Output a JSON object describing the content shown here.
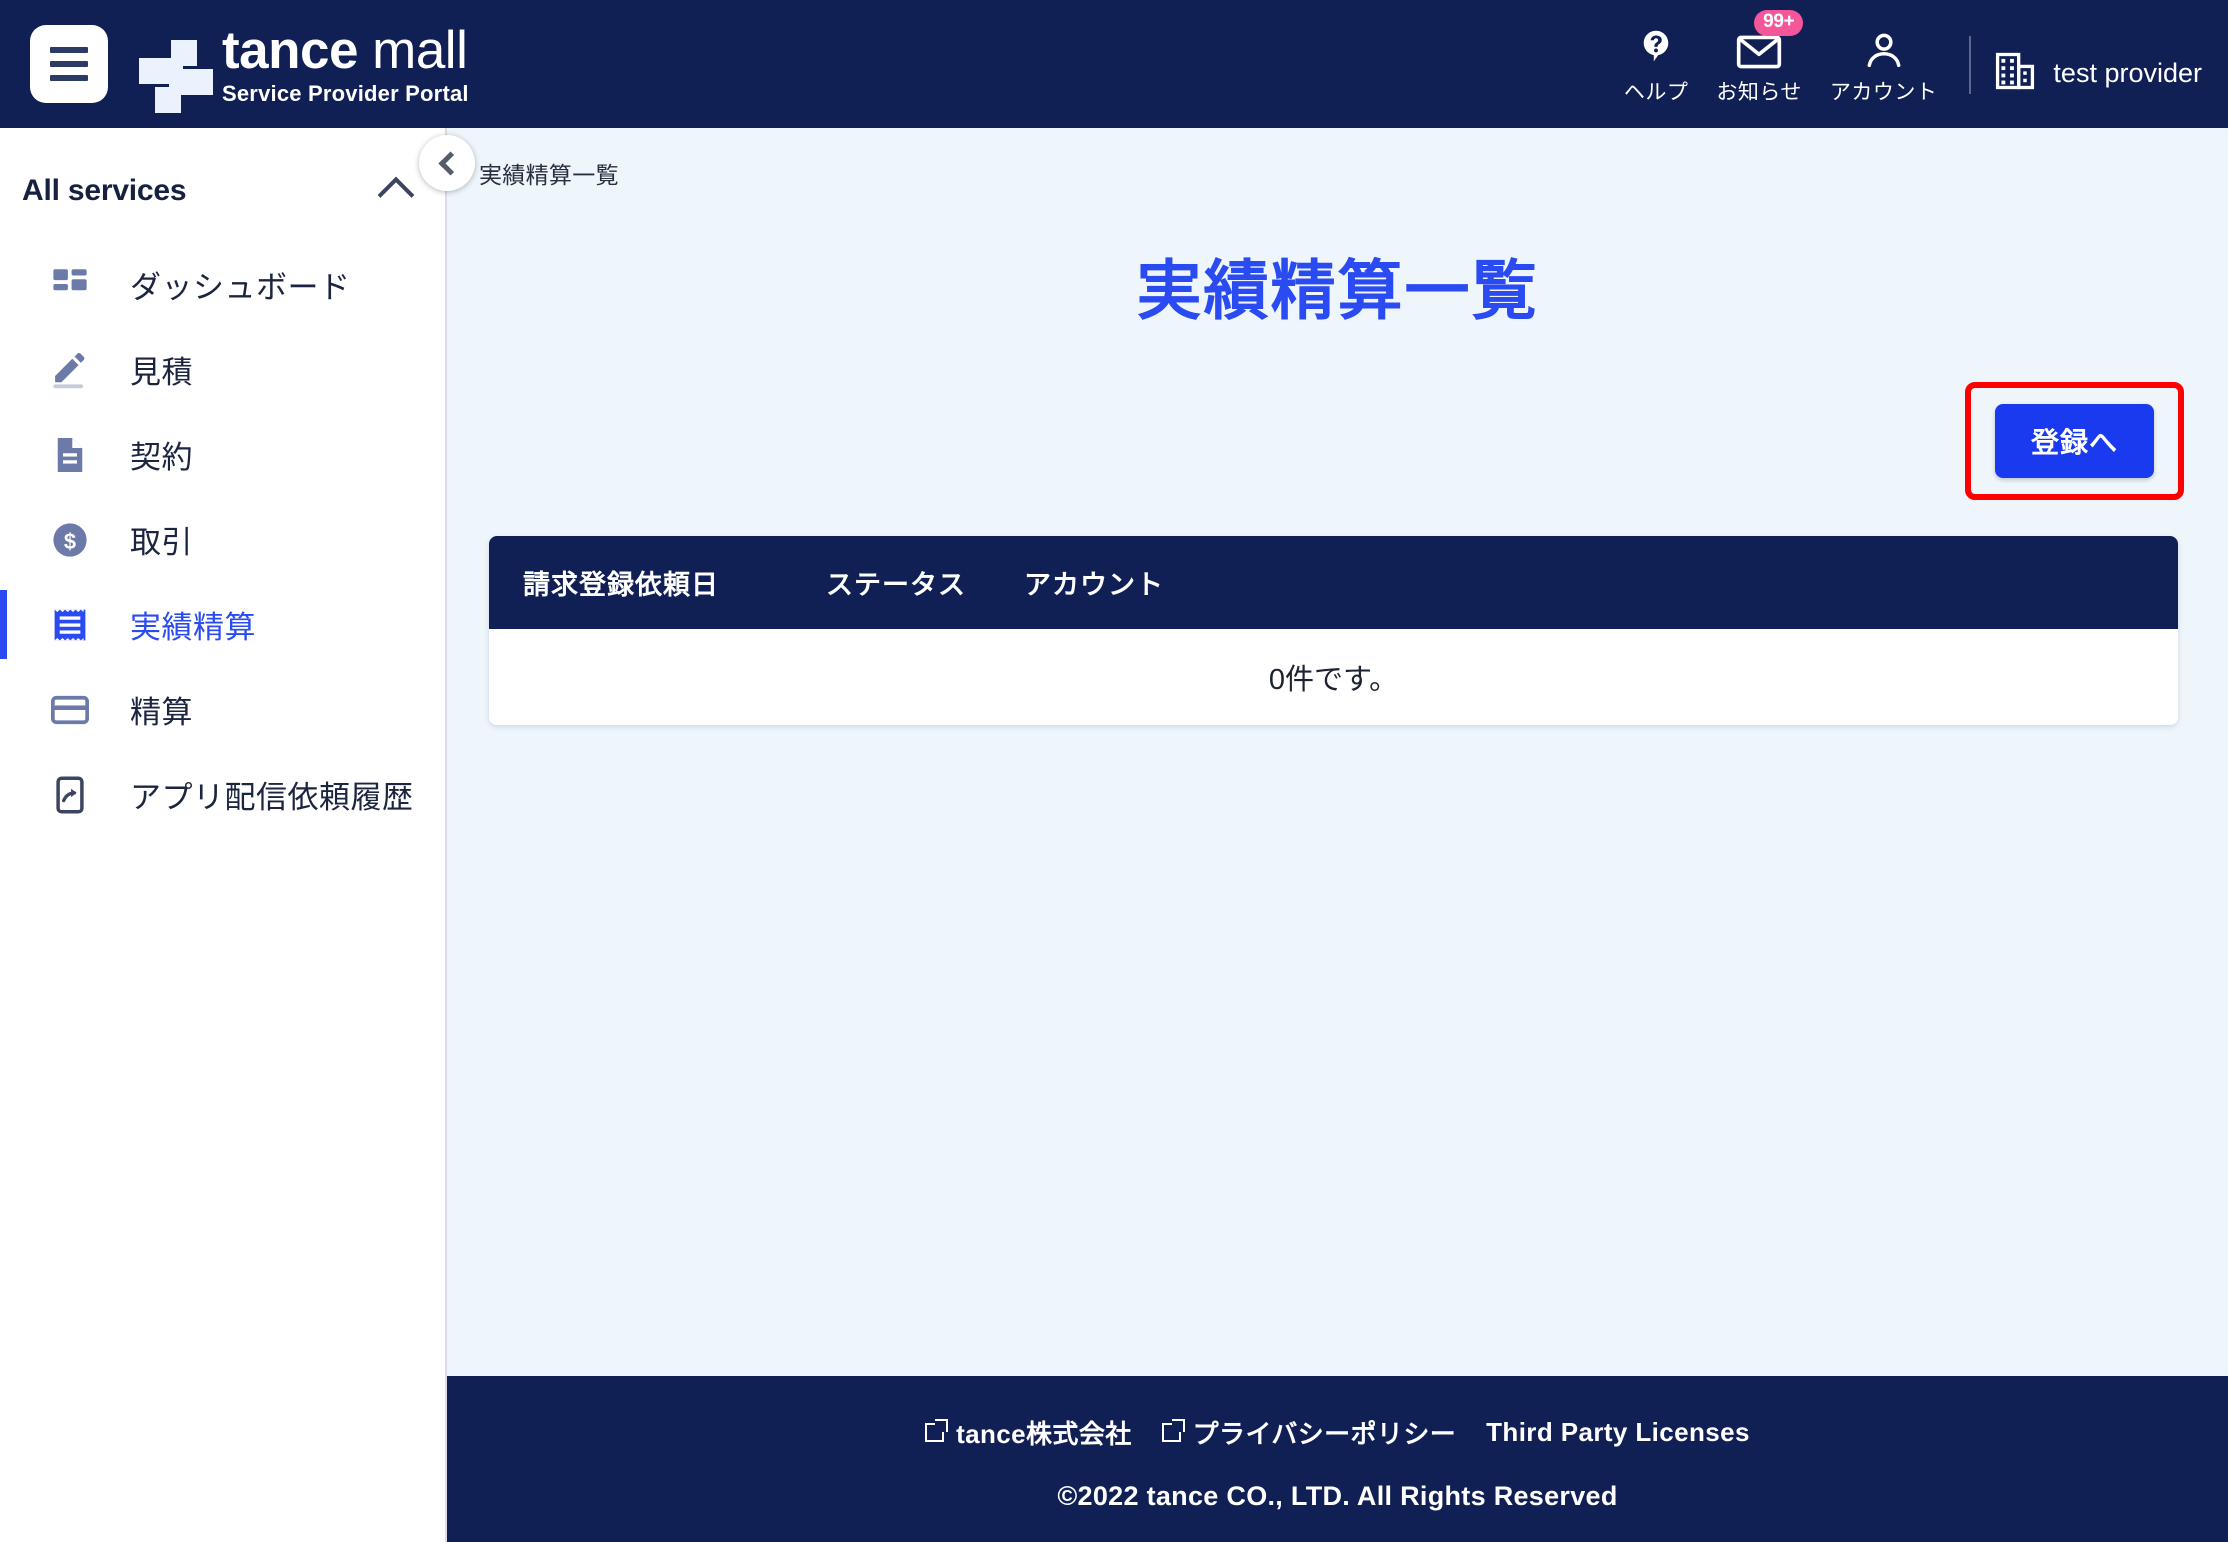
{
  "header": {
    "menu_icon": "hamburger-icon",
    "logo": {
      "brand_bold": "tance",
      "brand_light": " mall",
      "subtitle": "Service Provider Portal",
      "mark_icon": "tance-logo-mark"
    },
    "actions": [
      {
        "icon": "help-icon",
        "label": "ヘルプ",
        "badge": null
      },
      {
        "icon": "mail-icon",
        "label": "お知らせ",
        "badge": "99+"
      },
      {
        "icon": "person-icon",
        "label": "アカウント",
        "badge": null
      }
    ],
    "provider": {
      "icon": "building-icon",
      "name": "test provider"
    },
    "badge_color": "#f4569a"
  },
  "sidebar": {
    "section_label": "All services",
    "collapse_icon": "chevron-up-icon",
    "panel_collapse_icon": "chevron-left-icon",
    "items": [
      {
        "label": "ダッシュボード",
        "icon": "dashboard-icon",
        "active": false
      },
      {
        "label": "見積",
        "icon": "pencil-icon",
        "active": false
      },
      {
        "label": "契約",
        "icon": "document-icon",
        "active": false
      },
      {
        "label": "取引",
        "icon": "dollar-coin-icon",
        "active": false
      },
      {
        "label": "実績精算",
        "icon": "receipt-icon",
        "active": true
      },
      {
        "label": "精算",
        "icon": "credit-card-icon",
        "active": false
      },
      {
        "label": "アプリ配信依頼履歴",
        "icon": "app-share-icon",
        "active": false
      }
    ],
    "active_color": "#2b4bf2"
  },
  "main": {
    "breadcrumb": "実績精算一覧",
    "page_title": "実績精算一覧",
    "register_button": "登録へ",
    "highlight_color": "#ff0000",
    "table": {
      "columns": [
        "請求登録依頼日",
        "ステータス",
        "アカウント"
      ],
      "rows": [],
      "empty_message": "0件です。"
    }
  },
  "footer": {
    "links": [
      {
        "label": "tance株式会社",
        "external": true
      },
      {
        "label": "プライバシーポリシー",
        "external": true
      },
      {
        "label": "Third Party Licenses",
        "external": false
      }
    ],
    "copyright": "©2022 tance CO., LTD. All Rights Reserved"
  }
}
